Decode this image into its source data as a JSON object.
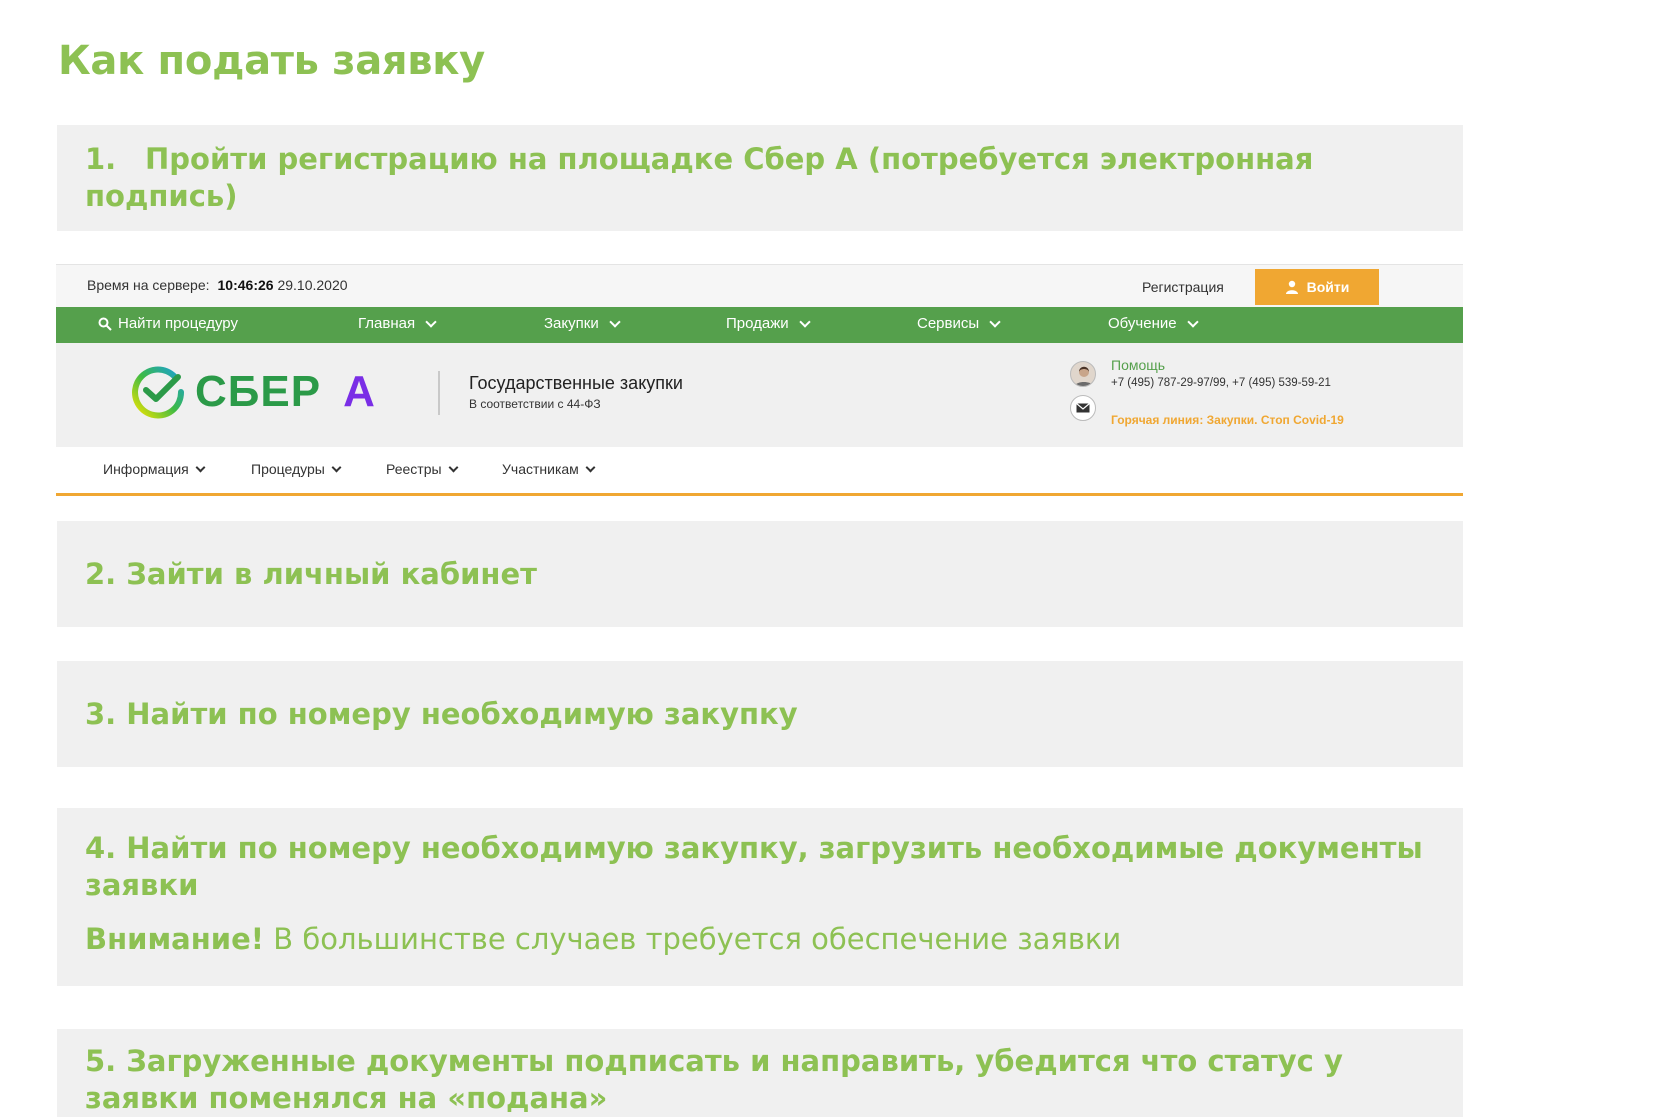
{
  "page": {
    "title": "Как подать заявку"
  },
  "steps": {
    "s1_num": "1.",
    "s1_text": "Пройти регистрацию на площадке Сбер А (потребуется электронная подпись)",
    "s2_text": "2. Зайти в личный кабинет",
    "s3_text": "3. Найти по номеру необходимую закупку",
    "s4_text": "4. Найти по номеру необходимую закупку, загрузить необходимые документы заявки",
    "s4_note_bold": "Внимание!",
    "s4_note_rest": " В большинстве случаев требуется обеспечение заявки",
    "s5_text": "5. Загруженные документы подписать и направить, убедится что статус у заявки поменялся на «подана»"
  },
  "site": {
    "server_time_label": "Время на сервере:",
    "server_time_clock": "10:46:26",
    "server_time_date": "29.10.2020",
    "register_link": "Регистрация",
    "login_button": "Войти",
    "nav": {
      "search": "Найти процедуру",
      "home": "Главная",
      "purchases": "Закупки",
      "sales": "Продажи",
      "services": "Сервисы",
      "training": "Обучение"
    },
    "logo_text": "СБЕР",
    "logo_letter": "А",
    "brand_title": "Государственные закупки",
    "brand_subtitle": "В соответствии с 44-ФЗ",
    "help_label": "Помощь",
    "help_phones": "+7 (495) 787-29-97/99, +7 (495) 539-59-21",
    "hotline": "Горячая линия: Закупки. Стоп Covid-19",
    "subnav": {
      "info": "Информация",
      "procedures": "Процедуры",
      "registries": "Реестры",
      "participants": "Участникам"
    }
  },
  "colors": {
    "accent_green": "#8dc153",
    "nav_green": "#55a04c",
    "orange": "#f0a732",
    "box_bg": "#f0f0f0",
    "logo_purple": "#7a2ee6"
  }
}
